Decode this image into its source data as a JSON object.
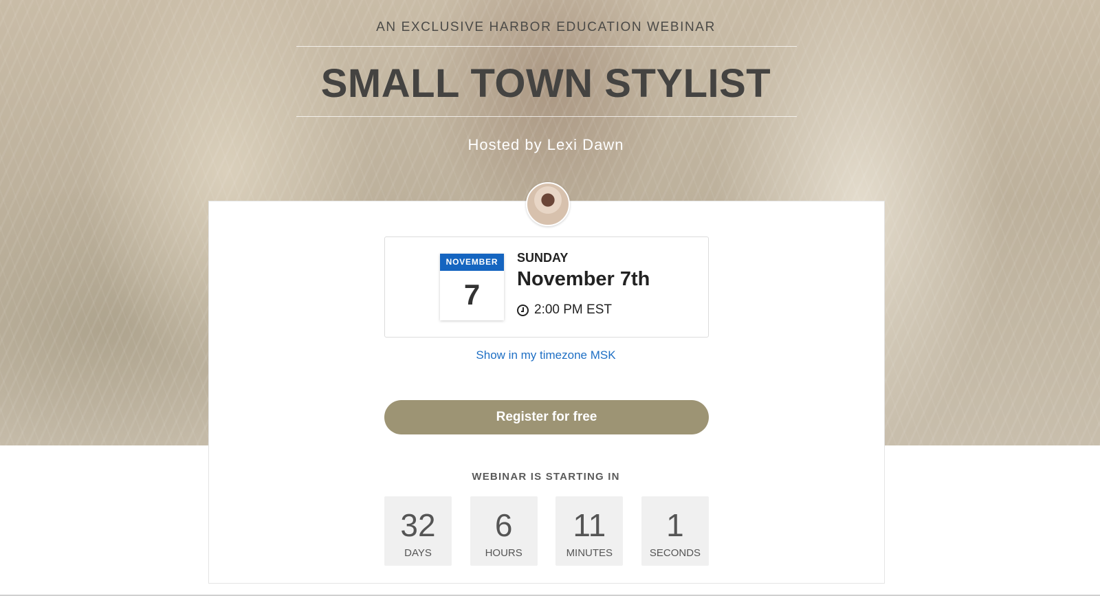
{
  "hero": {
    "kicker": "AN EXCLUSIVE HARBOR EDUCATION WEBINAR",
    "title": "SMALL TOWN STYLIST",
    "host": "Hosted by Lexi Dawn"
  },
  "event": {
    "calendar_month": "NOVEMBER",
    "calendar_day": "7",
    "weekday": "SUNDAY",
    "date_long": "November 7th",
    "time": "2:00 PM EST",
    "timezone_link": "Show in my timezone MSK"
  },
  "cta": {
    "register_label": "Register for free"
  },
  "countdown": {
    "label": "WEBINAR IS STARTING IN",
    "units": [
      {
        "value": "32",
        "unit": "DAYS"
      },
      {
        "value": "6",
        "unit": "HOURS"
      },
      {
        "value": "11",
        "unit": "MINUTES"
      },
      {
        "value": "1",
        "unit": "SECONDS"
      }
    ]
  },
  "colors": {
    "accent_button": "#9d9474",
    "calendar_header": "#1565c0",
    "link": "#1e6fc4"
  },
  "icons": {
    "time": "clock-icon",
    "host": "avatar"
  }
}
